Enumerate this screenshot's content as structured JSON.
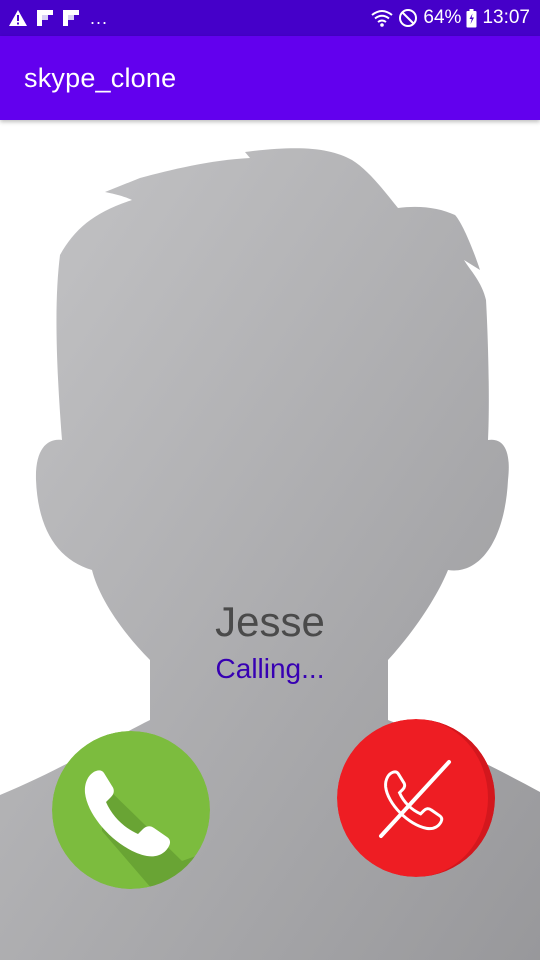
{
  "status_bar": {
    "battery_percent": "64%",
    "time": "13:07",
    "overflow": "...",
    "icons": [
      "warning-icon",
      "flipboard-icon",
      "flipboard-icon",
      "wifi-icon",
      "do-not-disturb-icon",
      "battery-icon"
    ]
  },
  "app_bar": {
    "title": "skype_clone"
  },
  "call": {
    "caller_name": "Jesse",
    "status": "Calling...",
    "accept_icon": "phone-icon",
    "decline_icon": "phone-off-icon"
  },
  "colors": {
    "status_bar": "#4500c9",
    "app_bar": "#6200ee",
    "accept": "#7cbc3e",
    "decline": "#ee1d23",
    "calling_text": "#3700b3"
  }
}
